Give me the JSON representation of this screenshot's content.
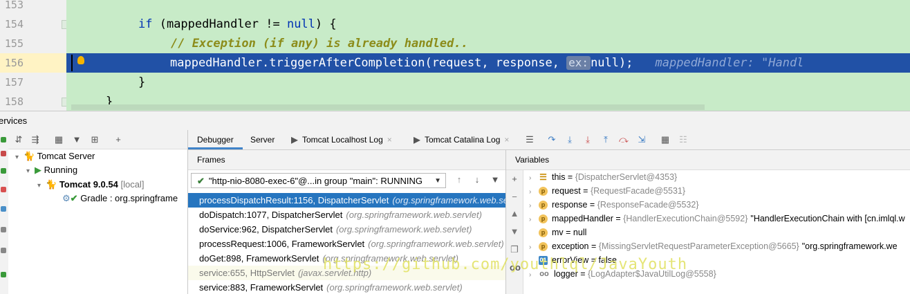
{
  "editor": {
    "line_numbers": [
      "153",
      "154",
      "155",
      "156",
      "157",
      "158"
    ],
    "line154": {
      "kw_if": "if",
      "part1": " (mappedHandler != ",
      "kw_null": "null",
      "part2": ") {"
    },
    "line155": {
      "comment": "// Exception (if any) is already handled.."
    },
    "line156": {
      "part1": "mappedHandler.triggerAfterCompletion(request, response, ",
      "hint": "ex:",
      "part2": "null);",
      "inline_value": "mappedHandler: \"Handl"
    },
    "line157": {
      "text": "}"
    },
    "line158": {
      "text": "}"
    }
  },
  "services": {
    "title": "ervices",
    "tree": {
      "tomcat_server": "Tomcat Server",
      "running": "Running",
      "tomcat_version": "Tomcat 9.0.54",
      "tomcat_local": "[local]",
      "gradle": "Gradle : org.springframe"
    }
  },
  "debugger": {
    "tabs": [
      "Debugger",
      "Server",
      "Tomcat Localhost Log",
      "Tomcat Catalina Log"
    ],
    "frames_title": "Frames",
    "thread": "\"http-nio-8080-exec-6\"@...in group \"main\": RUNNING",
    "frames": [
      {
        "method": "processDispatchResult:1156, DispatcherServlet",
        "pkg": "(org.springframework.web.se",
        "state": "selected"
      },
      {
        "method": "doDispatch:1077, DispatcherServlet",
        "pkg": "(org.springframework.web.servlet)",
        "state": "normal"
      },
      {
        "method": "doService:962, DispatcherServlet",
        "pkg": "(org.springframework.web.servlet)",
        "state": "normal"
      },
      {
        "method": "processRequest:1006, FrameworkServlet",
        "pkg": "(org.springframework.web.servlet)",
        "state": "normal"
      },
      {
        "method": "doGet:898, FrameworkServlet",
        "pkg": "(org.springframework.web.servlet)",
        "state": "normal"
      },
      {
        "method": "service:655, HttpServlet",
        "pkg": "(javax.servlet.http)",
        "state": "library"
      },
      {
        "method": "service:883, FrameworkServlet",
        "pkg": "(org.springframework.web.servlet)",
        "state": "normal"
      }
    ],
    "variables_title": "Variables",
    "variables": [
      {
        "icon": "this",
        "name": "this",
        "value": "{DispatcherServlet@4353}",
        "extra": ""
      },
      {
        "icon": "p",
        "name": "request",
        "value": "{RequestFacade@5531}",
        "extra": ""
      },
      {
        "icon": "p",
        "name": "response",
        "value": "{ResponseFacade@5532}",
        "extra": ""
      },
      {
        "icon": "p",
        "name": "mappedHandler",
        "value": "{HandlerExecutionChain@5592}",
        "extra": "\"HandlerExecutionChain with [cn.imlql.w"
      },
      {
        "icon": "p",
        "name": "mv",
        "value": "",
        "extra": "null"
      },
      {
        "icon": "p",
        "name": "exception",
        "value": "{MissingServletRequestParameterException@5665}",
        "extra": "\"org.springframework.we"
      },
      {
        "icon": "f",
        "name": "errorView",
        "value": "",
        "extra": "false"
      },
      {
        "icon": "oo",
        "name": "logger",
        "value": "{LogAdapter$JavaUtilLog@5558}",
        "extra": ""
      }
    ]
  },
  "watermark": "https://github.com/youthlql/JavaYouth",
  "colors": {
    "editor_bg": "#c8ebc8",
    "exec_line": "#2151a6",
    "selected_frame": "#2675bf",
    "keyword": "#0033b3",
    "comment": "#8c8c1a"
  }
}
